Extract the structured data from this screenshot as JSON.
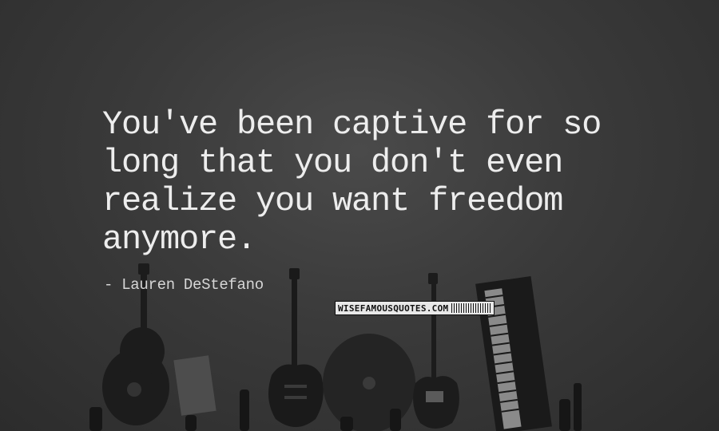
{
  "quote": {
    "lines": [
      "You've been captive for so",
      "long that you don't even",
      "realize you want freedom",
      "anymore."
    ],
    "author": "- Lauren DeStefano"
  },
  "watermark": {
    "text": "WISEFAMOUSQUOTES.COM"
  },
  "colors": {
    "background": "#3a3a3a",
    "text": "#ededed"
  }
}
